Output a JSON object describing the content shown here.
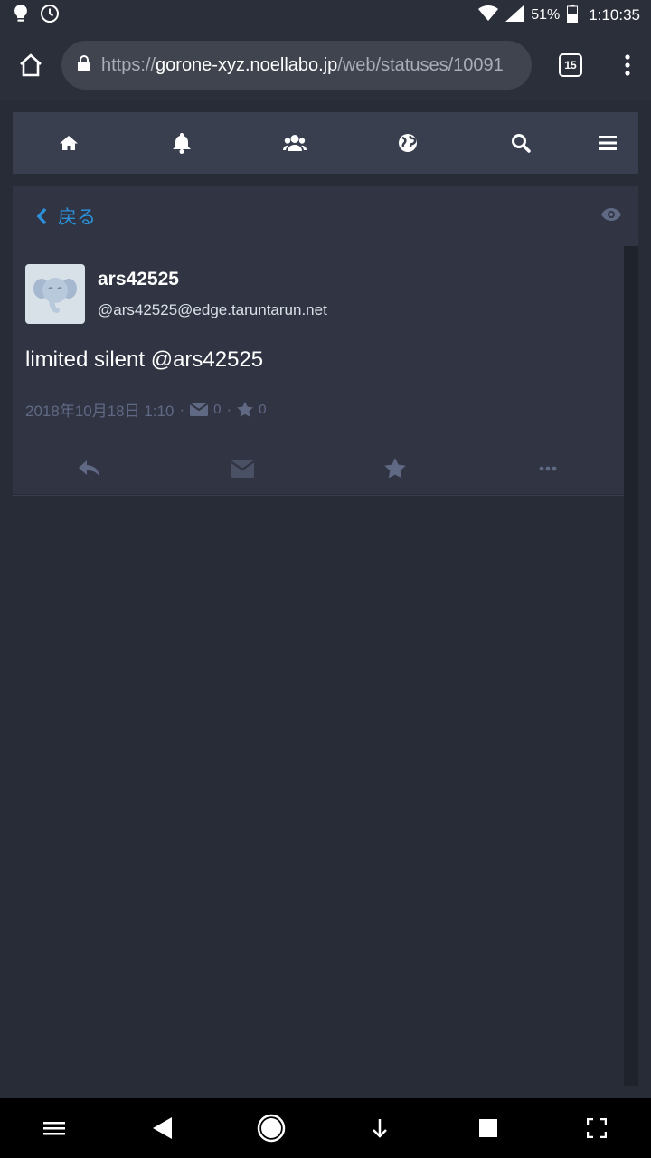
{
  "status_bar": {
    "battery_percent": "51%",
    "time": "1:10:35",
    "icons": [
      "bulb-icon",
      "alarm-icon",
      "wifi-icon",
      "signal-icon",
      "battery-icon"
    ]
  },
  "browser": {
    "url_scheme": "https://",
    "url_host": "gorone-xyz.noellabo.jp",
    "url_path": "/web/statuses/10091",
    "tab_count": "15"
  },
  "app_nav": {
    "items": [
      "home-icon",
      "bell-icon",
      "users-icon",
      "globe-icon",
      "search-icon",
      "bars-icon"
    ]
  },
  "column": {
    "back_label": "戻る"
  },
  "status": {
    "display_name": "ars42525",
    "acct": "@ars42525@edge.taruntarun.net",
    "content": "limited silent @ars42525",
    "timestamp": "2018年10月18日 1:10",
    "separator": "·",
    "dm_count": "0",
    "fav_count": "0"
  },
  "colors": {
    "accent": "#2b90d9",
    "background": "#282c37",
    "panel": "#313543",
    "nav": "#393f4f",
    "muted": "#606984"
  }
}
